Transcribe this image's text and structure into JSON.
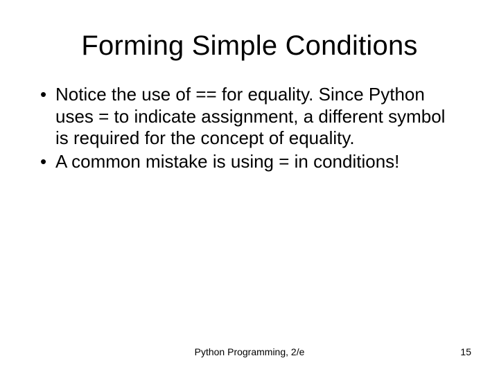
{
  "slide": {
    "title": "Forming Simple Conditions",
    "bullets": [
      "Notice the use of == for equality. Since Python uses = to indicate assignment, a different symbol is required for the concept of equality.",
      "A common mistake is using = in conditions!"
    ],
    "footer_center": "Python Programming, 2/e",
    "footer_right": "15"
  }
}
